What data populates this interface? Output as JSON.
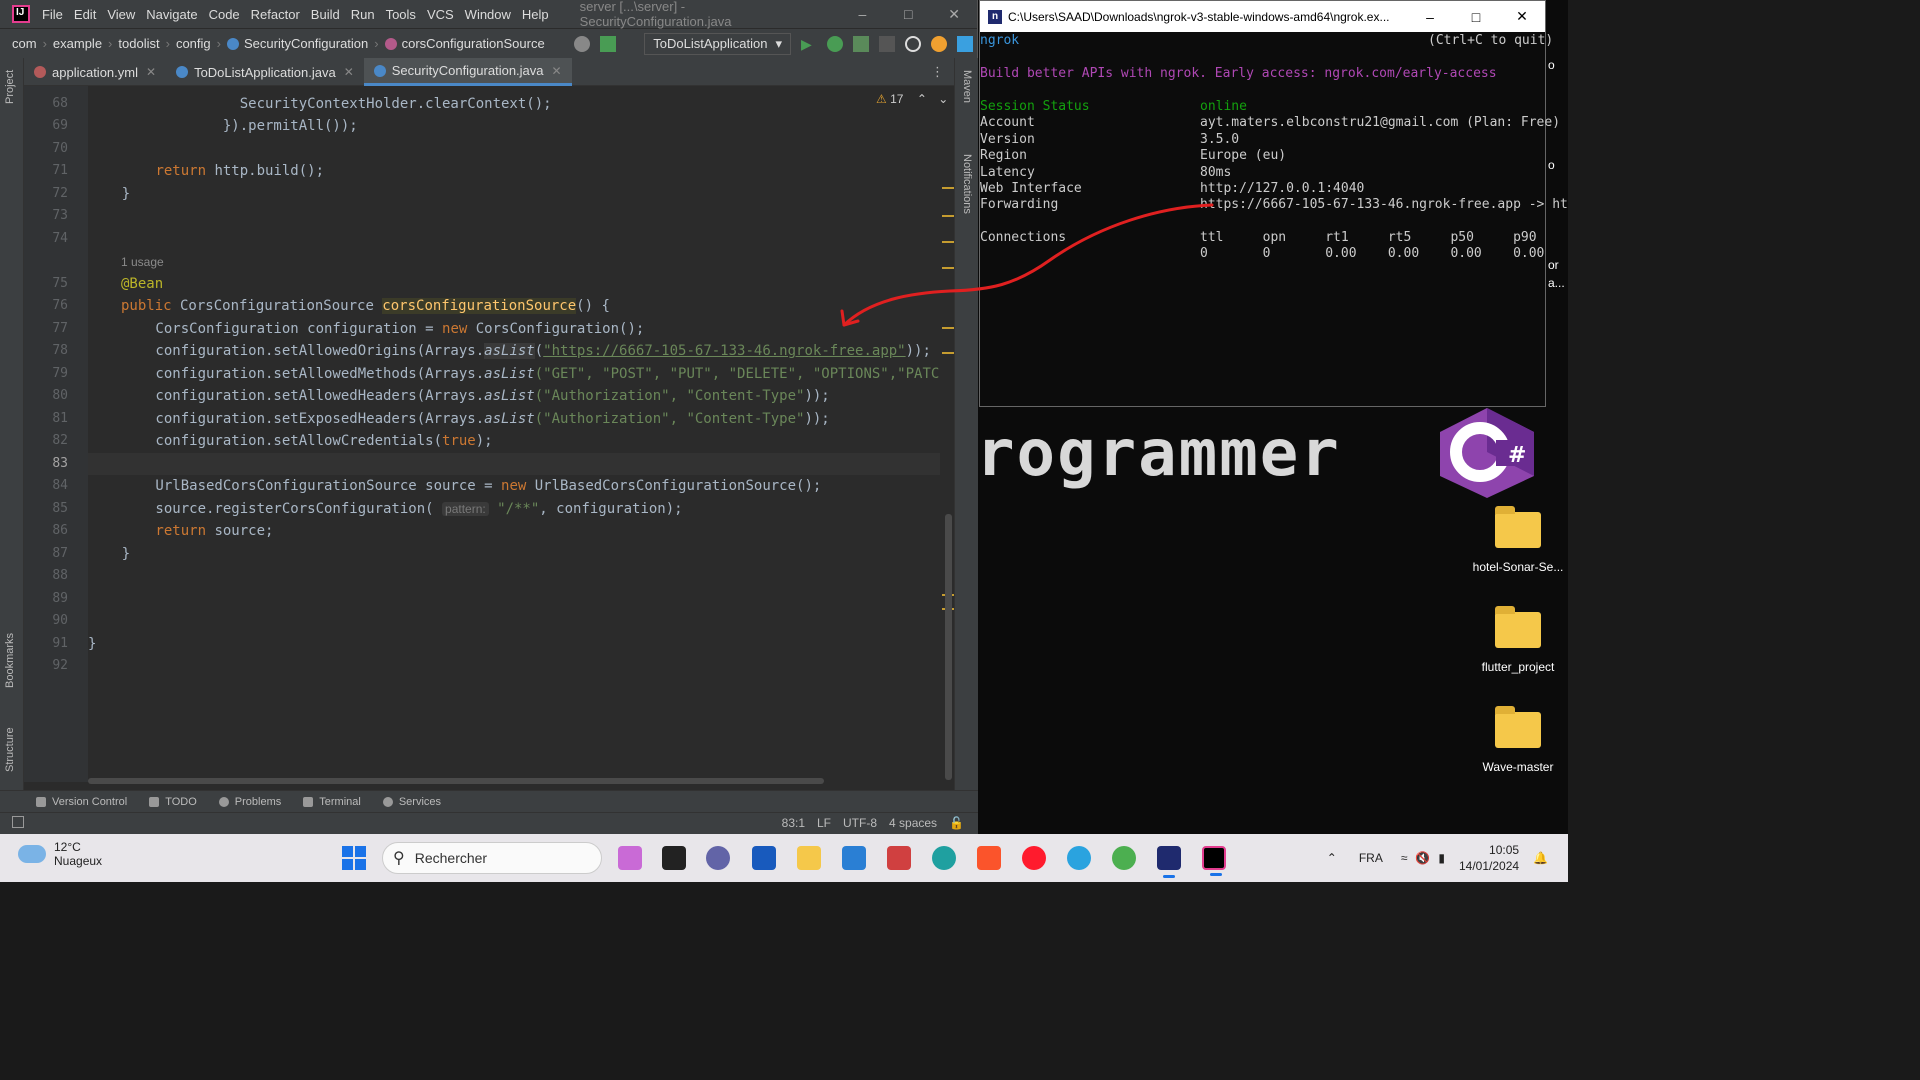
{
  "ide": {
    "menu": [
      "File",
      "Edit",
      "View",
      "Navigate",
      "Code",
      "Refactor",
      "Build",
      "Run",
      "Tools",
      "VCS",
      "Window",
      "Help"
    ],
    "window_title": "server [...\\server] - SecurityConfiguration.java",
    "breadcrumbs": [
      "com",
      "example",
      "todolist",
      "config",
      "SecurityConfiguration",
      "corsConfigurationSource"
    ],
    "run_config": "ToDoListApplication",
    "tabs": [
      {
        "label": "application.yml",
        "color": "#b35a5a"
      },
      {
        "label": "ToDoListApplication.java",
        "color": "#4a88c7"
      },
      {
        "label": "SecurityConfiguration.java",
        "color": "#4a88c7"
      }
    ],
    "warnings": "17",
    "side_left": [
      "Project",
      "Bookmarks",
      "Structure"
    ],
    "side_right": [
      "Maven",
      "Notifications"
    ],
    "line_numbers": [
      "68",
      "69",
      "70",
      "71",
      "72",
      "73",
      "74",
      "75",
      "76",
      "77",
      "78",
      "79",
      "80",
      "81",
      "82",
      "83",
      "84",
      "85",
      "86",
      "87",
      "88",
      "89",
      "90",
      "91",
      "92"
    ],
    "code": {
      "l68": "                  SecurityContextHolder.clearContext();",
      "l69": "                }).permitAll());",
      "l71_kw": "return",
      "l71_rest": " http.build();",
      "l72": "    }",
      "usage": "1 usage",
      "l75": "@Bean",
      "l76_kw": "public",
      "l76_type": " CorsConfigurationSource ",
      "l76_fn": "corsConfigurationSource",
      "l76_end": "() {",
      "l77a": "        CorsConfiguration configuration = ",
      "l77_kw": "new",
      "l77b": " CorsConfiguration();",
      "l78a": "        configuration.setAllowedOrigins(Arrays.",
      "l78_fn": "asList",
      "l78_open": "(",
      "l78_url": "\"https://6667-105-67-133-46.ngrok-free.app\"",
      "l78_end": "));",
      "l79a": "        configuration.setAllowedMethods(Arrays.",
      "l79_fn": "asList",
      "l79_str": "(\"GET\", \"POST\", \"PUT\", \"DELETE\", \"OPTIONS\",\"PATCH\"",
      "l79_end": "));",
      "l80a": "        configuration.setAllowedHeaders(Arrays.",
      "l80_fn": "asList",
      "l80_str": "(\"Authorization\", \"Content-Type\"",
      "l80_end": "));",
      "l81a": "        configuration.setExposedHeaders(Arrays.",
      "l81_fn": "asList",
      "l81_str": "(\"Authorization\", \"Content-Type\"",
      "l81_end": "));",
      "l82a": "        configuration.setAllowCredentials(",
      "l82_kw": "true",
      "l82_end": ");",
      "l84a": "        UrlBasedCorsConfigurationSource source = ",
      "l84_kw": "new",
      "l84b": " UrlBasedCorsConfigurationSource();",
      "l85a": "        source.registerCorsConfiguration( ",
      "l85_hint": "pattern:",
      "l85_str": " \"/**\"",
      "l85_end": ", configuration);",
      "l86_kw": "        return",
      "l86_rest": " source;",
      "l87": "    }",
      "l91": "}"
    },
    "bottom_tabs": [
      "Version Control",
      "TODO",
      "Problems",
      "Terminal",
      "Services"
    ],
    "status": {
      "position": "83:1",
      "line_sep": "LF",
      "encoding": "UTF-8",
      "indent": "4 spaces"
    }
  },
  "terminal": {
    "title": "C:\\Users\\SAAD\\Downloads\\ngrok-v3-stable-windows-amd64\\ngrok.ex...",
    "app": "ngrok",
    "quit_hint": "(Ctrl+C to quit)",
    "promo": "Build better APIs with ngrok. Early access: ngrok.com/early-access",
    "rows": [
      {
        "k": "Session Status",
        "v": "online"
      },
      {
        "k": "Account",
        "v": "ayt.maters.elbconstru21@gmail.com (Plan: Free)"
      },
      {
        "k": "Version",
        "v": "3.5.0"
      },
      {
        "k": "Region",
        "v": "Europe (eu)"
      },
      {
        "k": "Latency",
        "v": "80ms"
      },
      {
        "k": "Web Interface",
        "v": "http://127.0.0.1:4040"
      },
      {
        "k": "Forwarding",
        "v": "https://6667-105-67-133-46.ngrok-free.app -> ht"
      }
    ],
    "connections_label": "Connections",
    "conn_headers": "ttl     opn     rt1     rt5     p50     p90",
    "conn_values": "0       0       0.00    0.00    0.00    0.00"
  },
  "desktop": {
    "banner": "rogrammer",
    "icons": [
      "hotel-Sonar-Se...",
      "flutter_project",
      "Wave-master"
    ],
    "edge_text": [
      "o",
      "o",
      "or",
      "a..."
    ]
  },
  "taskbar": {
    "temp": "12°C",
    "weather": "Nuageux",
    "search_placeholder": "Rechercher",
    "lang": "FRA",
    "time": "10:05",
    "date": "14/01/2024"
  }
}
